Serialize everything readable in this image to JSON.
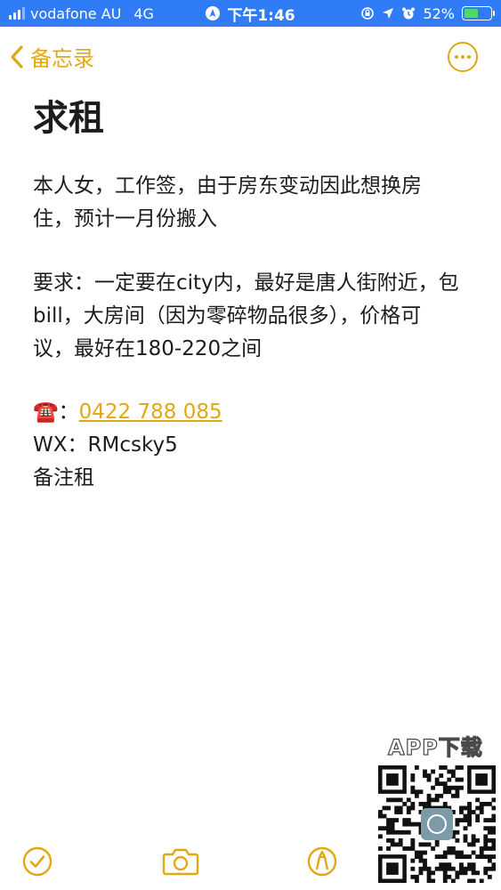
{
  "status_bar": {
    "carrier": "vodafone AU",
    "network": "4G",
    "time": "下午1:46",
    "battery": "52%",
    "battery_level": 0.52,
    "background": "#2f7cf6"
  },
  "nav": {
    "back_label": "备忘录",
    "back_icon": "chevron-left-icon",
    "more_icon": "ellipsis-circle-icon",
    "accent": "#e0a812"
  },
  "note": {
    "title": "求租",
    "paragraph1": "本人女，工作签，由于房东变动因此想换房住，预计一月份搬入",
    "paragraph2": "要求：一定要在city内，最好是唐人街附近，包bill，大房间（因为零碎物品很多），价格可议，最好在180-220之间",
    "phone_emoji": "☎️",
    "phone_sep": "：",
    "phone_number": "0422 788 085",
    "wechat": "WX：RMcsky5",
    "footer": "备注租"
  },
  "watermark": {
    "label": "APP下载",
    "qr_icon": "qr-code-icon"
  },
  "toolbar": {
    "items": [
      "checklist-icon",
      "camera-icon",
      "markup-pen-icon"
    ]
  }
}
